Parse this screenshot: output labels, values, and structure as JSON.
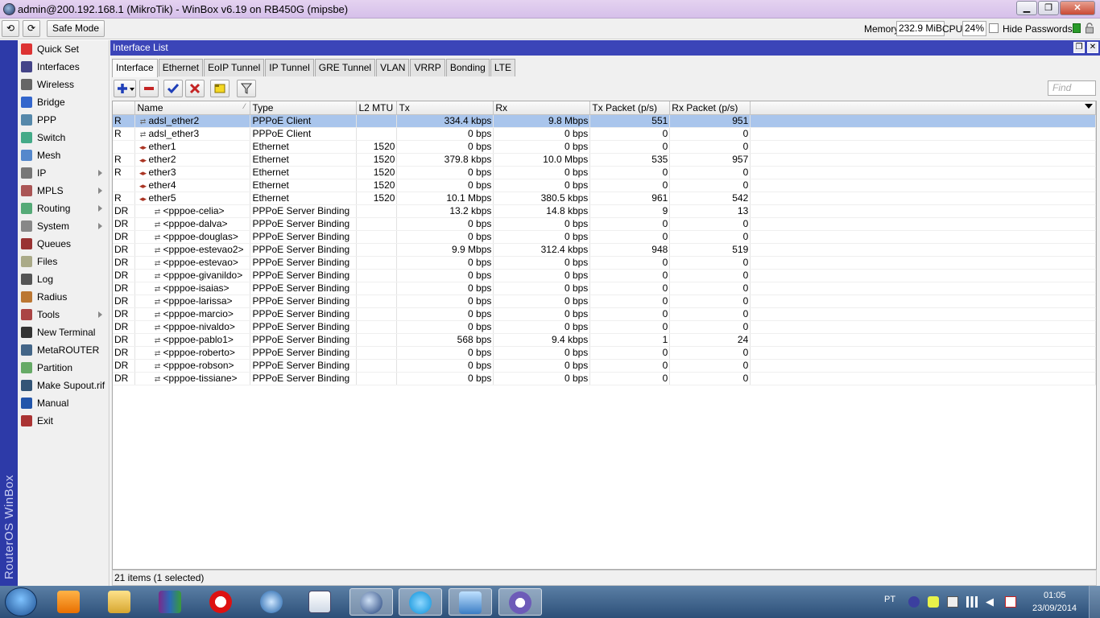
{
  "window": {
    "title": "admin@200.192.168.1 (MikroTik) - WinBox v6.19 on RB450G (mipsbe)",
    "minimize_label": "▁",
    "maximize_label": "❐",
    "close_label": "✕"
  },
  "toolbar": {
    "undo_label": "⟲",
    "redo_label": "⟳",
    "safe_mode_label": "Safe Mode",
    "memory_label": "Memory:",
    "memory_value": "232.9 MiB",
    "cpu_label": "CPU:",
    "cpu_value": "24%",
    "hide_passwords_label": "Hide Passwords"
  },
  "brand": {
    "vertical_text": "RouterOS WinBox"
  },
  "sidebar": {
    "items": [
      {
        "label": "Quick Set",
        "icon": "quick-set-icon",
        "submenu": false
      },
      {
        "label": "Interfaces",
        "icon": "interfaces-icon",
        "submenu": false
      },
      {
        "label": "Wireless",
        "icon": "wireless-icon",
        "submenu": false
      },
      {
        "label": "Bridge",
        "icon": "bridge-icon",
        "submenu": false
      },
      {
        "label": "PPP",
        "icon": "ppp-icon",
        "submenu": false
      },
      {
        "label": "Switch",
        "icon": "switch-icon",
        "submenu": false
      },
      {
        "label": "Mesh",
        "icon": "mesh-icon",
        "submenu": false
      },
      {
        "label": "IP",
        "icon": "ip-icon",
        "submenu": true
      },
      {
        "label": "MPLS",
        "icon": "mpls-icon",
        "submenu": true
      },
      {
        "label": "Routing",
        "icon": "routing-icon",
        "submenu": true
      },
      {
        "label": "System",
        "icon": "system-icon",
        "submenu": true
      },
      {
        "label": "Queues",
        "icon": "queues-icon",
        "submenu": false
      },
      {
        "label": "Files",
        "icon": "files-icon",
        "submenu": false
      },
      {
        "label": "Log",
        "icon": "log-icon",
        "submenu": false
      },
      {
        "label": "Radius",
        "icon": "radius-icon",
        "submenu": false
      },
      {
        "label": "Tools",
        "icon": "tools-icon",
        "submenu": true
      },
      {
        "label": "New Terminal",
        "icon": "terminal-icon",
        "submenu": false
      },
      {
        "label": "MetaROUTER",
        "icon": "metarouter-icon",
        "submenu": false
      },
      {
        "label": "Partition",
        "icon": "partition-icon",
        "submenu": false
      },
      {
        "label": "Make Supout.rif",
        "icon": "supout-icon",
        "submenu": false
      },
      {
        "label": "Manual",
        "icon": "manual-icon",
        "submenu": false
      },
      {
        "label": "Exit",
        "icon": "exit-icon",
        "submenu": false
      }
    ]
  },
  "main": {
    "window_title": "Interface List",
    "restore_label": "❐",
    "close_label": "✕",
    "tabs": [
      "Interface",
      "Ethernet",
      "EoIP Tunnel",
      "IP Tunnel",
      "GRE Tunnel",
      "VLAN",
      "VRRP",
      "Bonding",
      "LTE"
    ],
    "active_tab": "Interface",
    "actions": {
      "add": "add-icon",
      "remove": "remove-icon",
      "enable": "check-icon",
      "disable": "x-icon",
      "comment": "comment-icon",
      "filter": "filter-icon"
    },
    "find_placeholder": "Find",
    "columns": [
      "",
      "Name",
      "Type",
      "L2 MTU",
      "Tx",
      "Rx",
      "Tx Packet (p/s)",
      "Rx Packet (p/s)"
    ],
    "rows": [
      {
        "flag": "R",
        "name": "adsl_ether2",
        "type": "PPPoE Client",
        "mtu": "",
        "tx": "334.4 kbps",
        "rx": "9.8 Mbps",
        "txp": "551",
        "rxp": "951",
        "icon": "pppoe",
        "indent": false,
        "selected": true
      },
      {
        "flag": "R",
        "name": "adsl_ether3",
        "type": "PPPoE Client",
        "mtu": "",
        "tx": "0 bps",
        "rx": "0 bps",
        "txp": "0",
        "rxp": "0",
        "icon": "pppoe",
        "indent": false,
        "selected": false
      },
      {
        "flag": "",
        "name": "ether1",
        "type": "Ethernet",
        "mtu": "1520",
        "tx": "0 bps",
        "rx": "0 bps",
        "txp": "0",
        "rxp": "0",
        "icon": "ether",
        "indent": false,
        "selected": false
      },
      {
        "flag": "R",
        "name": "ether2",
        "type": "Ethernet",
        "mtu": "1520",
        "tx": "379.8 kbps",
        "rx": "10.0 Mbps",
        "txp": "535",
        "rxp": "957",
        "icon": "ether",
        "indent": false,
        "selected": false
      },
      {
        "flag": "R",
        "name": "ether3",
        "type": "Ethernet",
        "mtu": "1520",
        "tx": "0 bps",
        "rx": "0 bps",
        "txp": "0",
        "rxp": "0",
        "icon": "ether",
        "indent": false,
        "selected": false
      },
      {
        "flag": "",
        "name": "ether4",
        "type": "Ethernet",
        "mtu": "1520",
        "tx": "0 bps",
        "rx": "0 bps",
        "txp": "0",
        "rxp": "0",
        "icon": "ether",
        "indent": false,
        "selected": false
      },
      {
        "flag": "R",
        "name": "ether5",
        "type": "Ethernet",
        "mtu": "1520",
        "tx": "10.1 Mbps",
        "rx": "380.5 kbps",
        "txp": "961",
        "rxp": "542",
        "icon": "ether",
        "indent": false,
        "selected": false
      },
      {
        "flag": "DR",
        "name": "<pppoe-celia>",
        "type": "PPPoE Server Binding",
        "mtu": "",
        "tx": "13.2 kbps",
        "rx": "14.8 kbps",
        "txp": "9",
        "rxp": "13",
        "icon": "pppoe",
        "indent": true,
        "selected": false
      },
      {
        "flag": "DR",
        "name": "<pppoe-dalva>",
        "type": "PPPoE Server Binding",
        "mtu": "",
        "tx": "0 bps",
        "rx": "0 bps",
        "txp": "0",
        "rxp": "0",
        "icon": "pppoe",
        "indent": true,
        "selected": false
      },
      {
        "flag": "DR",
        "name": "<pppoe-douglas>",
        "type": "PPPoE Server Binding",
        "mtu": "",
        "tx": "0 bps",
        "rx": "0 bps",
        "txp": "0",
        "rxp": "0",
        "icon": "pppoe",
        "indent": true,
        "selected": false
      },
      {
        "flag": "DR",
        "name": "<pppoe-estevao2>",
        "type": "PPPoE Server Binding",
        "mtu": "",
        "tx": "9.9 Mbps",
        "rx": "312.4 kbps",
        "txp": "948",
        "rxp": "519",
        "icon": "pppoe",
        "indent": true,
        "selected": false
      },
      {
        "flag": "DR",
        "name": "<pppoe-estevao>",
        "type": "PPPoE Server Binding",
        "mtu": "",
        "tx": "0 bps",
        "rx": "0 bps",
        "txp": "0",
        "rxp": "0",
        "icon": "pppoe",
        "indent": true,
        "selected": false
      },
      {
        "flag": "DR",
        "name": "<pppoe-givanildo>",
        "type": "PPPoE Server Binding",
        "mtu": "",
        "tx": "0 bps",
        "rx": "0 bps",
        "txp": "0",
        "rxp": "0",
        "icon": "pppoe",
        "indent": true,
        "selected": false
      },
      {
        "flag": "DR",
        "name": "<pppoe-isaias>",
        "type": "PPPoE Server Binding",
        "mtu": "",
        "tx": "0 bps",
        "rx": "0 bps",
        "txp": "0",
        "rxp": "0",
        "icon": "pppoe",
        "indent": true,
        "selected": false
      },
      {
        "flag": "DR",
        "name": "<pppoe-larissa>",
        "type": "PPPoE Server Binding",
        "mtu": "",
        "tx": "0 bps",
        "rx": "0 bps",
        "txp": "0",
        "rxp": "0",
        "icon": "pppoe",
        "indent": true,
        "selected": false
      },
      {
        "flag": "DR",
        "name": "<pppoe-marcio>",
        "type": "PPPoE Server Binding",
        "mtu": "",
        "tx": "0 bps",
        "rx": "0 bps",
        "txp": "0",
        "rxp": "0",
        "icon": "pppoe",
        "indent": true,
        "selected": false
      },
      {
        "flag": "DR",
        "name": "<pppoe-nivaldo>",
        "type": "PPPoE Server Binding",
        "mtu": "",
        "tx": "0 bps",
        "rx": "0 bps",
        "txp": "0",
        "rxp": "0",
        "icon": "pppoe",
        "indent": true,
        "selected": false
      },
      {
        "flag": "DR",
        "name": "<pppoe-pablo1>",
        "type": "PPPoE Server Binding",
        "mtu": "",
        "tx": "568 bps",
        "rx": "9.4 kbps",
        "txp": "1",
        "rxp": "24",
        "icon": "pppoe",
        "indent": true,
        "selected": false
      },
      {
        "flag": "DR",
        "name": "<pppoe-roberto>",
        "type": "PPPoE Server Binding",
        "mtu": "",
        "tx": "0 bps",
        "rx": "0 bps",
        "txp": "0",
        "rxp": "0",
        "icon": "pppoe",
        "indent": true,
        "selected": false
      },
      {
        "flag": "DR",
        "name": "<pppoe-robson>",
        "type": "PPPoE Server Binding",
        "mtu": "",
        "tx": "0 bps",
        "rx": "0 bps",
        "txp": "0",
        "rxp": "0",
        "icon": "pppoe",
        "indent": true,
        "selected": false
      },
      {
        "flag": "DR",
        "name": "<pppoe-tissiane>",
        "type": "PPPoE Server Binding",
        "mtu": "",
        "tx": "0 bps",
        "rx": "0 bps",
        "txp": "0",
        "rxp": "0",
        "icon": "pppoe",
        "indent": true,
        "selected": false
      }
    ],
    "status": "21 items (1 selected)"
  },
  "taskbar": {
    "language": "PT",
    "time": "01:05",
    "date": "23/09/2014",
    "apps": [
      "media-player-icon",
      "file-explorer-icon",
      "winrar-icon",
      "opera-icon",
      "quicktime-icon",
      "notepad-icon",
      "winbox-icon",
      "skype-icon",
      "network-app-icon",
      "bittorrent-icon"
    ]
  }
}
